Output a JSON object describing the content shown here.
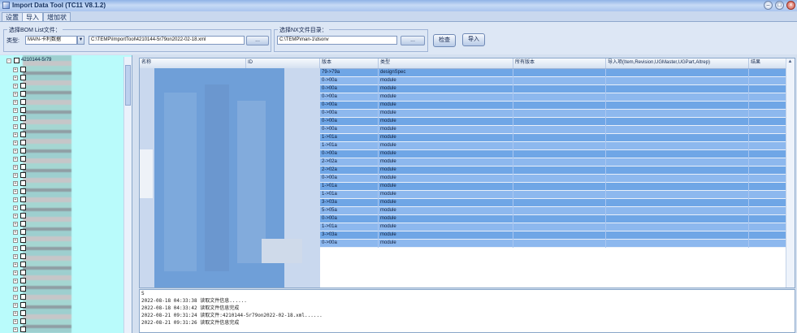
{
  "window": {
    "title": "Import Data Tool (TC11 V8.1.2)"
  },
  "window_buttons": [
    "–",
    "□",
    "×"
  ],
  "tabs": [
    {
      "label": "设置"
    },
    {
      "label": "导入"
    },
    {
      "label": "增加状"
    }
  ],
  "bom_group": {
    "legend": "选择BOM List文件：",
    "type_label": "类型:",
    "type_value": "MAIN-卡利数据",
    "file_path": "C:\\TEMP\\ImportTool\\4210144-5r79on2022-02-18.xml",
    "browse_label": "..."
  },
  "nx_group": {
    "legend": "选择NX文件目录：",
    "path": "C:\\TEMP\\man-1\\dsonv",
    "browse_label": "..."
  },
  "check_button": "检查",
  "import_button": "导入",
  "tree": {
    "root_label": "4210144-5r79",
    "child_expander": "+"
  },
  "grid": {
    "columns": [
      "名称",
      "ID",
      "版本",
      "类型",
      "所有版本",
      "导入项(Item,Revision,UGMaster,UGPart,Altrep)",
      "结果"
    ],
    "rows": [
      {
        "rev": "79->79a",
        "type": "designSpec"
      },
      {
        "rev": "0->00a",
        "type": "module"
      },
      {
        "rev": "0->00a",
        "type": "module"
      },
      {
        "rev": "0->00a",
        "type": "module"
      },
      {
        "rev": "0->00a",
        "type": "module"
      },
      {
        "rev": "0->00a",
        "type": "module"
      },
      {
        "rev": "0->00a",
        "type": "module"
      },
      {
        "rev": "0->00a",
        "type": "module"
      },
      {
        "rev": "1->01a",
        "type": "module"
      },
      {
        "rev": "1->01a",
        "type": "module"
      },
      {
        "rev": "0->00a",
        "type": "module"
      },
      {
        "rev": "2->02a",
        "type": "module"
      },
      {
        "rev": "2->02a",
        "type": "module"
      },
      {
        "rev": "0->00a",
        "type": "module"
      },
      {
        "rev": "1->01a",
        "type": "module"
      },
      {
        "rev": "1->01a",
        "type": "module"
      },
      {
        "rev": "3->03a",
        "type": "module"
      },
      {
        "rev": "5->05a",
        "type": "module"
      },
      {
        "rev": "0->00a",
        "type": "module"
      },
      {
        "rev": "1->01a",
        "type": "module"
      },
      {
        "rev": "3->03a",
        "type": "module"
      },
      {
        "rev": "0->00a",
        "type": "module"
      }
    ]
  },
  "log": [
    "S",
    "2022-08-18 04:33:38  读取文件信息......",
    "2022-08-18 04:33:42  读取文件信息完成",
    "2022-08-21 09:31:24  读取文件:4210144-5r79on2022-02-18.xml......",
    "2022-08-21 09:31:26  读取文件信息完成"
  ],
  "colors": {
    "row_selected": "#6fa6e6",
    "row_selected_alt": "#8db8ee",
    "tree_bg": "#b9fbfb",
    "window_bg": "#d4e0f0"
  }
}
